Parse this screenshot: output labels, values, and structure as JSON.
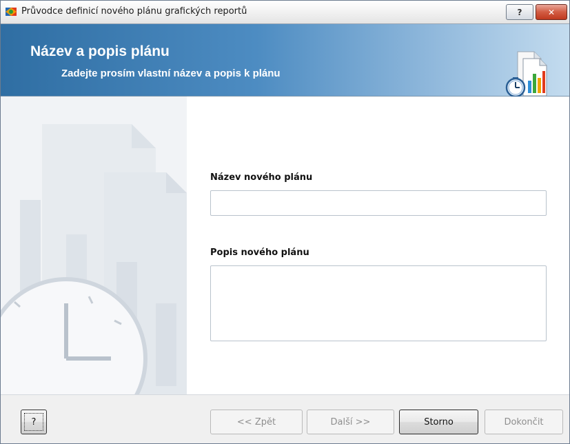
{
  "window": {
    "title": "Průvodce definicí nového plánu grafických reportů",
    "help_button": "?",
    "close_button": "✕"
  },
  "header": {
    "title": "Název a popis plánu",
    "subtitle": "Zadejte prosím vlastní název a popis k plánu"
  },
  "form": {
    "name_label": "Název nového plánu",
    "name_value": "",
    "description_label": "Popis nového plánu",
    "description_value": ""
  },
  "footer": {
    "help_label": "?",
    "back_label": "<< Zpět",
    "next_label": "Další >>",
    "cancel_label": "Storno",
    "finish_label": "Dokončit"
  },
  "colors": {
    "header_dark": "#2f6ea3",
    "header_light": "#c4dcef",
    "close_red": "#c0391f"
  }
}
